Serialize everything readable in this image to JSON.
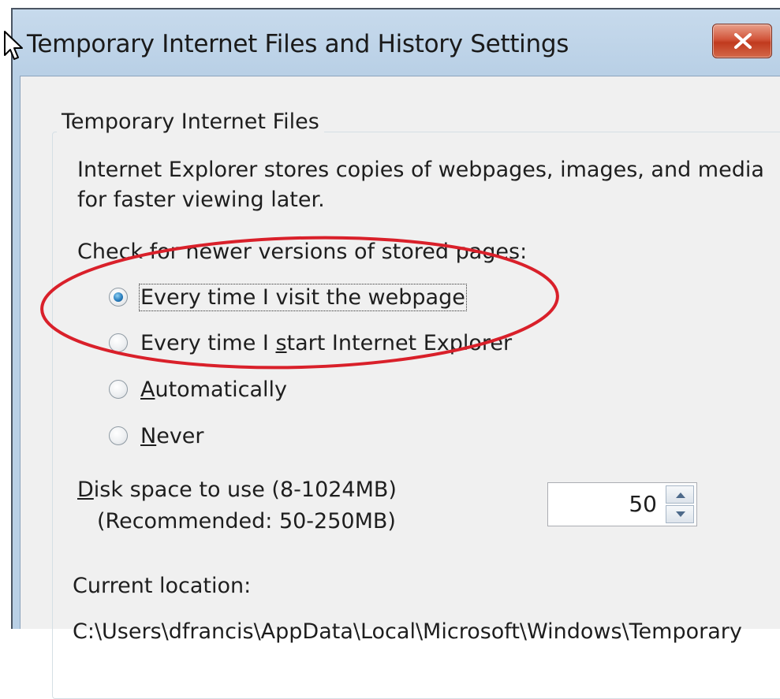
{
  "window": {
    "title": "Temporary Internet Files and History Settings"
  },
  "group": {
    "legend": "Temporary Internet Files",
    "description_line1": "Internet Explorer stores copies of webpages, images, and media",
    "description_line2": "for faster viewing later.",
    "check_label": "Check for newer versions of stored pages:"
  },
  "options": [
    {
      "pre": "Every time I visit the webpage",
      "key": "",
      "post": "",
      "checked": true
    },
    {
      "pre": "Every time I ",
      "key": "s",
      "post": "tart Internet Explorer",
      "checked": false
    },
    {
      "pre": "",
      "key": "A",
      "post": "utomatically",
      "checked": false
    },
    {
      "pre": "",
      "key": "N",
      "post": "ever",
      "checked": false
    }
  ],
  "disk": {
    "label_key": "D",
    "label_rest": "isk space to use (8-1024MB)",
    "recommended": "(Recommended: 50-250MB)",
    "value": "50"
  },
  "location": {
    "label": "Current location:",
    "path": "C:\\Users\\dfrancis\\AppData\\Local\\Microsoft\\Windows\\Temporary"
  },
  "colors": {
    "annotation_ellipse": "#d9202a",
    "close_button": "#c8462a",
    "radio_selected": "#2a7fbf"
  },
  "icons": {
    "close": "close-x-icon",
    "spin_up": "spin-up-arrow-icon",
    "spin_down": "spin-down-arrow-icon",
    "cursor": "mouse-pointer-icon"
  }
}
